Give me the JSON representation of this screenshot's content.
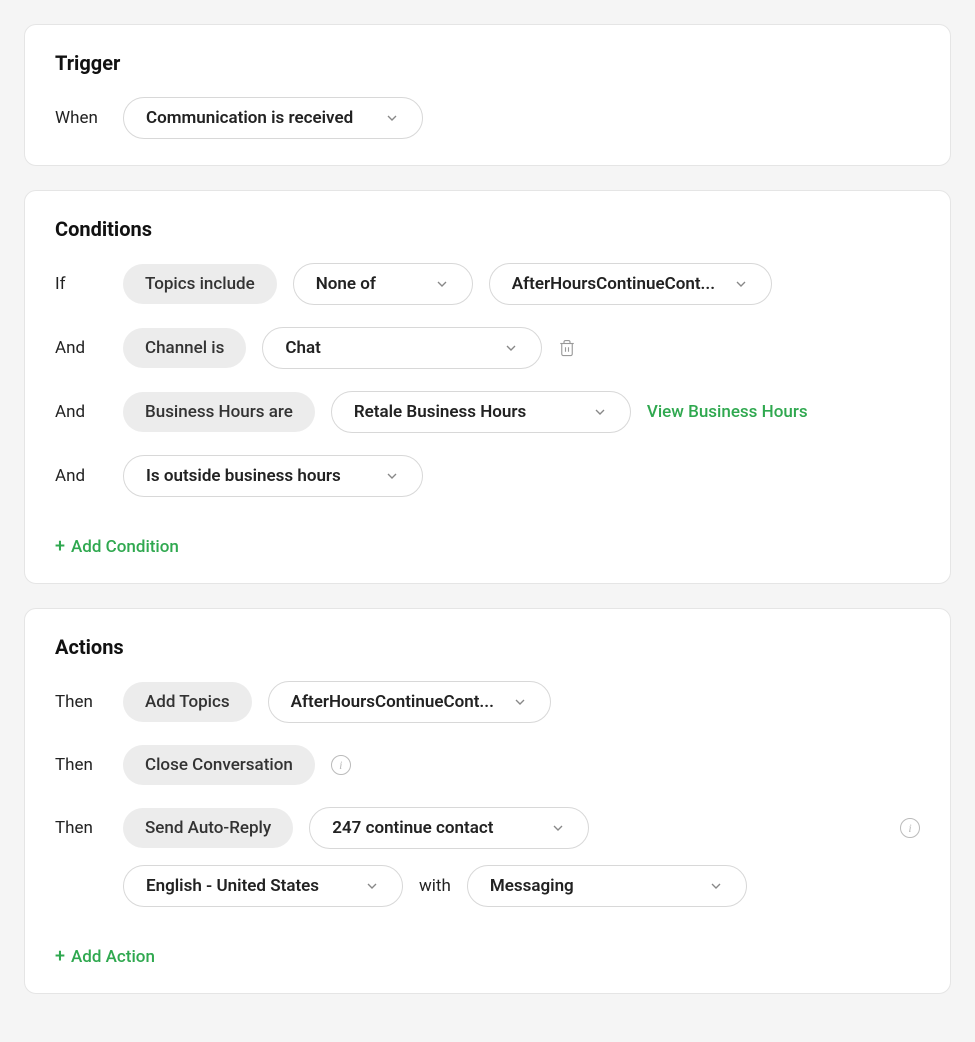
{
  "trigger": {
    "title": "Trigger",
    "prefix": "When",
    "value": "Communication is received"
  },
  "conditions": {
    "title": "Conditions",
    "rows": [
      {
        "prefix": "If",
        "type_label": "Topics include",
        "operator": "None of",
        "value": "AfterHoursContinueCont..."
      },
      {
        "prefix": "And",
        "type_label": "Channel is",
        "value": "Chat"
      },
      {
        "prefix": "And",
        "type_label": "Business Hours are",
        "value": "Retale Business Hours",
        "link": "View Business Hours"
      },
      {
        "prefix": "And",
        "value": "Is outside business hours"
      }
    ],
    "add_label": "Add Condition"
  },
  "actions": {
    "title": "Actions",
    "rows": [
      {
        "prefix": "Then",
        "type_label": "Add Topics",
        "value": "AfterHoursContinueCont..."
      },
      {
        "prefix": "Then",
        "type_label": "Close Conversation"
      },
      {
        "prefix": "Then",
        "type_label": "Send Auto-Reply",
        "value": "247 continue contact",
        "locale": "English - United States",
        "with_label": "with",
        "channel": "Messaging"
      }
    ],
    "add_label": "Add Action"
  }
}
